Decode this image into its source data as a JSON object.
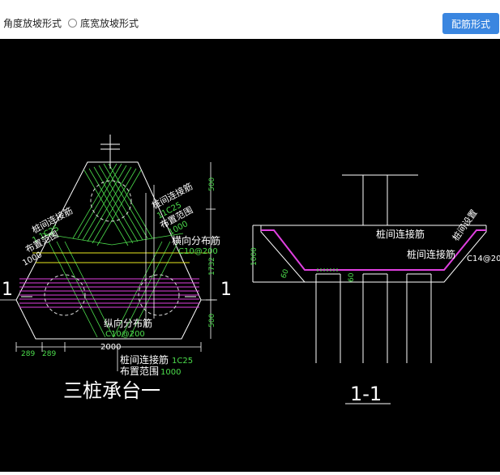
{
  "toolbar": {
    "option_angle": "角度放坡形式",
    "option_width": "底宽放坡形式",
    "rebar_button": "配筋形式"
  },
  "drawing": {
    "plan": {
      "section_mark_left": "1",
      "section_mark_right": "1",
      "pile_rebar_left_1": "桩间连接筋",
      "pile_rebar_left_2": "1 1C25",
      "pile_rebar_left_3": "布置范围",
      "pile_rebar_left_4": "1000",
      "pile_rebar_right_1": "桩间连接筋",
      "pile_rebar_right_2": "11C25",
      "pile_rebar_right_3": "布置范围",
      "pile_rebar_right_4": "1000",
      "transverse_label": "横向分布筋",
      "transverse_spec": "C10@200",
      "longitudinal_label": "纵向分布筋",
      "longitudinal_spec": "C10@200",
      "bottom_rebar_1": "桩间连接筋",
      "bottom_rebar_1_spec": "1C25",
      "bottom_range": "布置范围",
      "bottom_range_value": "1000",
      "dim_top": "500",
      "dim_mid": "1732",
      "dim_bottom": "500",
      "dim_289a": "289",
      "dim_289b": "289",
      "dim_2000": "2000",
      "title": "三桩承台一"
    },
    "section": {
      "pile_rebar_1": "桩间连接筋",
      "pile_rebar_2": "桩间连接筋",
      "right_note_1": "桩间设置",
      "right_spec": "C14@200",
      "dim_1000": "1000",
      "angle_left": "60",
      "angle_right": "60",
      "title": "1-1"
    }
  }
}
